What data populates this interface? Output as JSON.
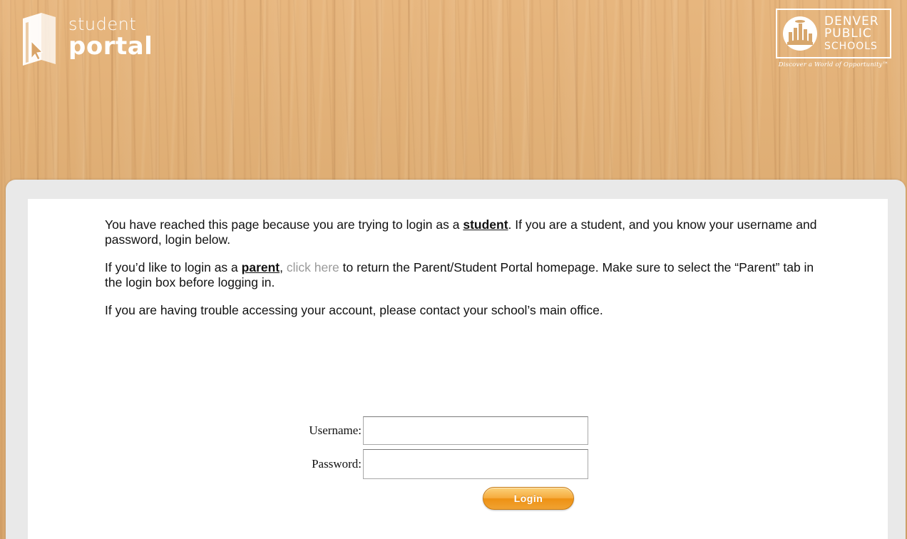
{
  "header": {
    "logo": {
      "word1": "student",
      "word2": "portal"
    },
    "district_logo": {
      "line1": "DENVER",
      "line2": "PUBLIC",
      "line3": "SCHOOLS",
      "tagline": "Discover a World of Opportunity™"
    }
  },
  "message": {
    "p1_before": "You have reached this page because you are trying to login as a ",
    "p1_bold": "student",
    "p1_after": ". If you are a student, and you know your username and password, login below.",
    "p2_before": "If you’d like to login as a ",
    "p2_bold": "parent",
    "p2_comma": ", ",
    "p2_link": "click here",
    "p2_after": " to return the Parent/Student Portal homepage. Make sure to select the “Parent” tab in the login box before logging in.",
    "p3": "If you are having trouble accessing your account, please contact your school’s main office."
  },
  "form": {
    "username_label": "Username:",
    "username_value": "",
    "password_label": "Password:",
    "password_value": "",
    "login_label": "Login"
  },
  "colors": {
    "wood": "#e2b27a",
    "card_border": "#e9e9e9",
    "link": "#9a9a9a",
    "button": "#f6ab3e"
  },
  "icons": {
    "portal_logo": "book-cursor-icon",
    "district_seal": "city-skyline-seal-icon"
  }
}
